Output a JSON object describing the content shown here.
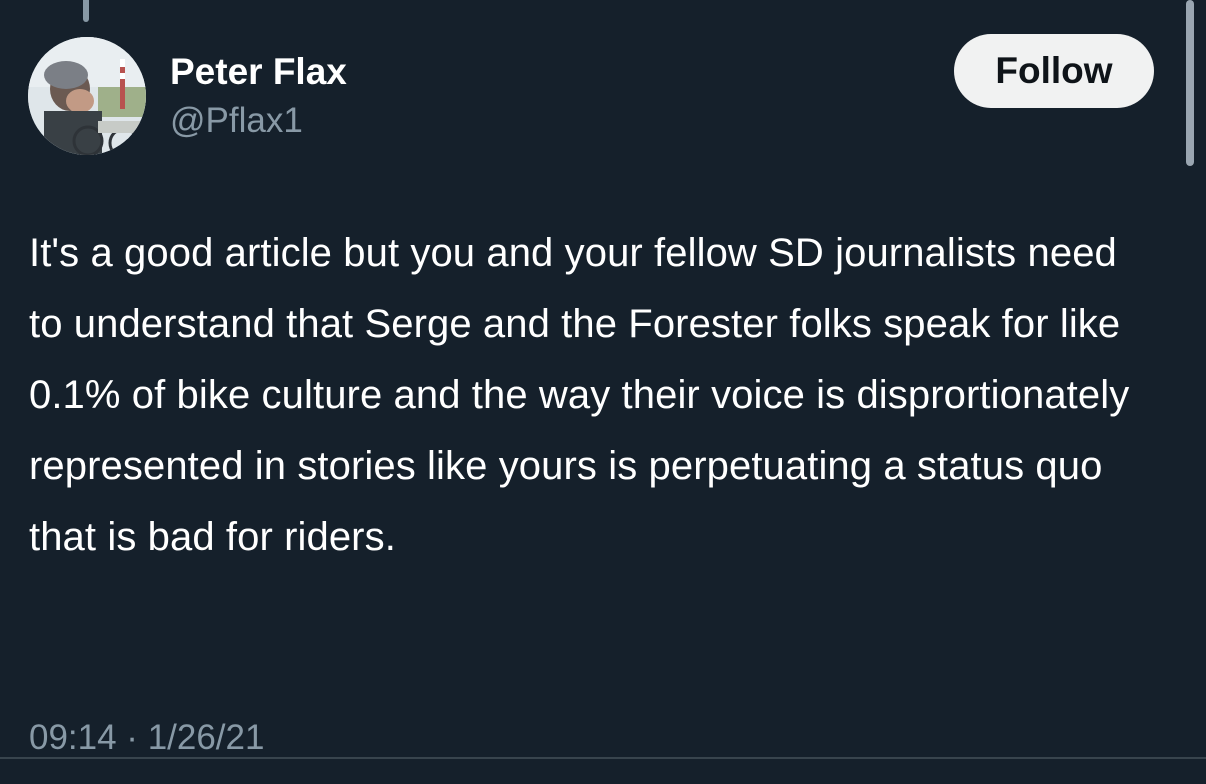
{
  "tweet": {
    "author": {
      "name": "Peter Flax",
      "handle": "@Pflax1",
      "avatar_icon": "profile-photo"
    },
    "follow_label": "Follow",
    "text": "It's a good article but you and your fellow SD journalists need to understand that Serge and the Forester folks speak for like 0.1% of bike culture and the way their voice is disprortionately represented in stories like yours is perpetuating a status quo that is bad for riders.",
    "timestamp": "09:14 · 1/26/21"
  },
  "colors": {
    "background": "#15202b",
    "text_primary": "#ffffff",
    "text_secondary": "#8899a6",
    "follow_bg": "#f1f2f2",
    "divider": "#38444d"
  }
}
